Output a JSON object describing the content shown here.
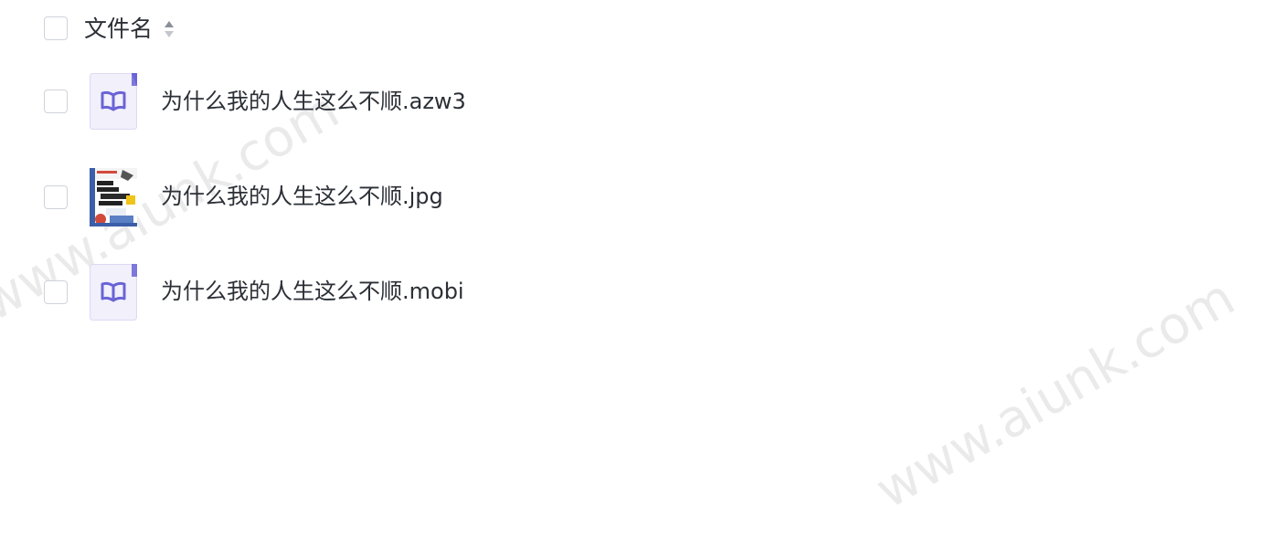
{
  "header": {
    "column_title": "文件名"
  },
  "files": [
    {
      "name": "为什么我的人生这么不顺.azw3",
      "type": "ebook",
      "icon": "ebook-icon"
    },
    {
      "name": "为什么我的人生这么不顺.jpg",
      "type": "image",
      "icon": "book-cover-thumbnail"
    },
    {
      "name": "为什么我的人生这么不顺.mobi",
      "type": "ebook",
      "icon": "ebook-icon"
    }
  ],
  "watermark": "www.aiunk.com",
  "colors": {
    "ebook_icon_accent": "#6a63d6",
    "ebook_icon_bg": "#f1f0fb",
    "checkbox_border": "#cfd3da",
    "text": "#2b2f36"
  }
}
